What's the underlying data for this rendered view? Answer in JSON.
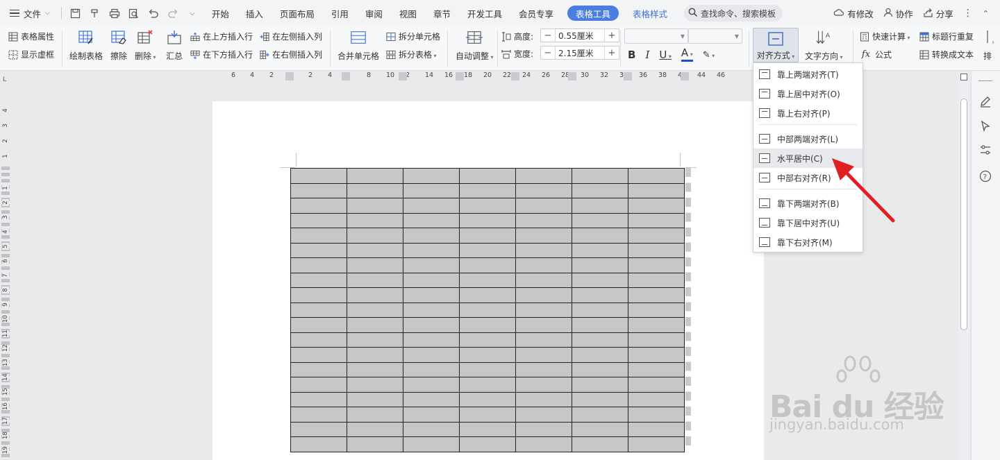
{
  "menu": {
    "file": "文件",
    "tabs": [
      "开始",
      "插入",
      "页面布局",
      "引用",
      "审阅",
      "视图",
      "章节",
      "开发工具",
      "会员专享"
    ],
    "table_tool": "表格工具",
    "table_style": "表格样式",
    "search_placeholder": "查找命令、搜索模板",
    "right": {
      "changes": "有修改",
      "collab": "协作",
      "share": "分享"
    }
  },
  "ribbon": {
    "table_props": "表格属性",
    "show_gridlines": "显示虚框",
    "draw_table": "绘制表格",
    "erase": "擦除",
    "delete": "删除",
    "summary": "汇总",
    "insert_above": "在上方插入行",
    "insert_below": "在下方插入行",
    "insert_left": "在左侧插入列",
    "insert_right": "在右侧插入列",
    "merge_cells": "合并单元格",
    "split_cells": "拆分单元格",
    "split_table": "拆分表格",
    "auto_fit": "自动调整",
    "height_label": "高度:",
    "height_value": "0.55厘米",
    "width_label": "宽度:",
    "width_value": "2.15厘米",
    "bold": "B",
    "italic": "I",
    "underline": "U",
    "font_color": "A",
    "align": "对齐方式",
    "text_direction": "文字方向",
    "quick_calc": "快速计算",
    "formula": "公式",
    "header_repeat": "标题行重复",
    "convert_text": "转换成文本",
    "sort": "排"
  },
  "ruler": {
    "h_ticks": [
      "6",
      "4",
      "2",
      "2",
      "4",
      "8",
      "10",
      "2",
      "14",
      "16",
      "18",
      "20",
      "22",
      "24",
      "26",
      "28",
      "30",
      "32",
      "34",
      "36",
      "38",
      "42",
      "44",
      "46"
    ],
    "v_ticks": [
      "4",
      "3",
      "2",
      "1",
      "1",
      "2",
      "3",
      "4",
      "5",
      "6",
      "7",
      "8",
      "9",
      "10",
      "11",
      "12",
      "13",
      "14",
      "15",
      "16",
      "17",
      "18",
      "19"
    ],
    "corner": "L"
  },
  "align_menu": {
    "items": [
      "靠上两端对齐(T)",
      "靠上居中对齐(O)",
      "靠上右对齐(P)",
      "中部两端对齐(L)",
      "水平居中(C)",
      "中部右对齐(R)",
      "靠下两端对齐(B)",
      "靠下居中对齐(U)",
      "靠下右对齐(M)"
    ],
    "highlighted_index": 4
  },
  "table": {
    "rows": 19,
    "cols": 7,
    "cell_color": "#c7c7c7"
  },
  "watermark": {
    "main": "Bai du 经验",
    "url": "jingyan.baidu.com"
  },
  "colors": {
    "accent": "#4a7ee0",
    "arrow": "#e02020"
  }
}
